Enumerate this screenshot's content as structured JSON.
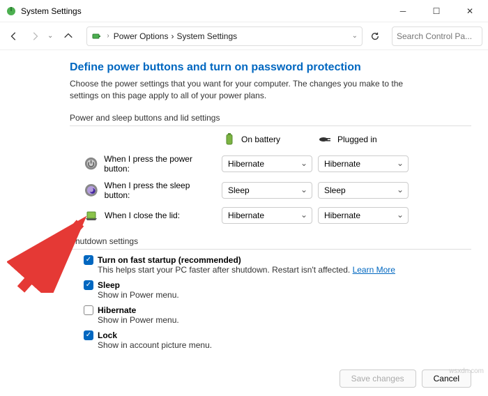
{
  "titlebar": {
    "title": "System Settings"
  },
  "toolbar": {
    "breadcrumb1": "Power Options",
    "breadcrumb2": "System Settings",
    "search_placeholder": "Search Control Pa..."
  },
  "content": {
    "heading": "Define power buttons and turn on password protection",
    "subtext": "Choose the power settings that you want for your computer. The changes you make to the settings on this page apply to all of your power plans.",
    "section1_label": "Power and sleep buttons and lid settings",
    "col_battery": "On battery",
    "col_plugged": "Plugged in",
    "row_power_label": "When I press the power button:",
    "row_sleep_label": "When I press the sleep button:",
    "row_lid_label": "When I close the lid:",
    "power_batt": "Hibernate",
    "power_plug": "Hibernate",
    "sleep_batt": "Sleep",
    "sleep_plug": "Sleep",
    "lid_batt": "Hibernate",
    "lid_plug": "Hibernate",
    "section2_label": "Shutdown settings",
    "chk_fast_label": "Turn on fast startup (recommended)",
    "chk_fast_help_a": "This helps start your PC faster after shutdown. Restart isn't affected. ",
    "chk_fast_help_link": "Learn More",
    "chk_sleep_label": "Sleep",
    "chk_sleep_help": "Show in Power menu.",
    "chk_hib_label": "Hibernate",
    "chk_hib_help": "Show in Power menu.",
    "chk_lock_label": "Lock",
    "chk_lock_help": "Show in account picture menu."
  },
  "footer": {
    "save": "Save changes",
    "cancel": "Cancel"
  },
  "watermark": "wsxdn.com"
}
